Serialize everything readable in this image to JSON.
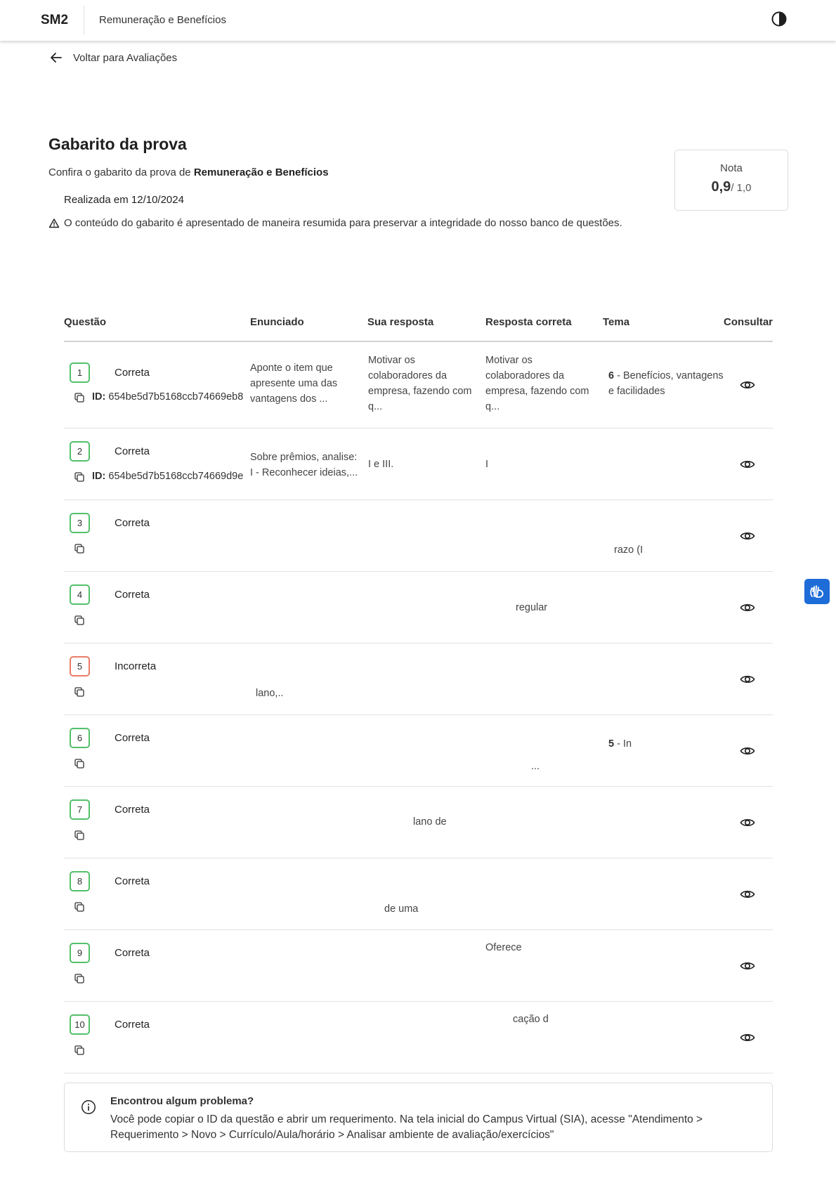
{
  "header": {
    "brand": "SM2",
    "course": "Remuneração e Benefícios"
  },
  "back_link": {
    "label": "Voltar para Avaliações"
  },
  "page": {
    "title": "Gabarito da prova",
    "subtitle_prefix": "Confira o gabarito da prova de ",
    "subtitle_course": "Remuneração e Benefícios",
    "date_line": "Realizada em 12/10/2024",
    "notice": "O conteúdo do gabarito é apresentado de maneira resumida para preservar a integridade do nosso banco de questões."
  },
  "grade": {
    "label": "Nota",
    "value": "0,9",
    "max": "/ 1,0"
  },
  "table": {
    "headers": {
      "questao": "Questão",
      "enunciado": "Enunciado",
      "sua_resposta": "Sua resposta",
      "resposta_correta": "Resposta correta",
      "tema": "Tema",
      "consultar": "Consultar"
    },
    "id_label": "ID:",
    "rows": [
      {
        "number": "1",
        "status": "Correta",
        "id": "654be5d7b5168ccb74669eb8",
        "enunciado": "Aponte o item que\napresente uma das\nvantagens dos ...",
        "sua_resposta": "Motivar os\ncolaboradores da\nempresa, fazendo com\nq...",
        "resposta_correta": "Motivar os\ncolaboradores da\nempresa, fazendo com\nq...",
        "tema_num": "6",
        "tema_text": " - Benefícios, vantagens\ne facilidades"
      },
      {
        "number": "2",
        "status": "Correta",
        "id": "654be5d7b5168ccb74669d9e",
        "enunciado": "Sobre prêmios, analise:\n   I - Reconhecer ideias,...",
        "sua_resposta": "I e III.",
        "resposta_correta": "I"
      },
      {
        "number": "3",
        "status": "Correta",
        "fragment": "razo (I"
      },
      {
        "number": "4",
        "status": "Correta",
        "fragment": "regular"
      },
      {
        "number": "5",
        "status": "Incorreta",
        "fragment": "lano,.."
      },
      {
        "number": "6",
        "status": "Correta",
        "tema_num": "5",
        "tema_text": " - In",
        "fragment": "..."
      },
      {
        "number": "7",
        "status": "Correta",
        "fragment": "lano de"
      },
      {
        "number": "8",
        "status": "Correta",
        "fragment": "de uma"
      },
      {
        "number": "9",
        "status": "Correta",
        "fragment": "Oferece"
      },
      {
        "number": "10",
        "status": "Correta",
        "fragment": "cação d"
      }
    ]
  },
  "problem": {
    "title": "Encontrou algum problema?",
    "text": "Você pode copiar o ID da questão e abrir um requerimento. Na tela inicial do Campus Virtual (SIA), acesse \"Atendimento > Requerimento > Novo > Currículo/Aula/horário > Analisar ambiente de avaliação/exercícios\""
  },
  "colors": {
    "correct": "#52c06a",
    "incorrect": "#ea7d66",
    "vlibras": "#1d6cd7"
  }
}
